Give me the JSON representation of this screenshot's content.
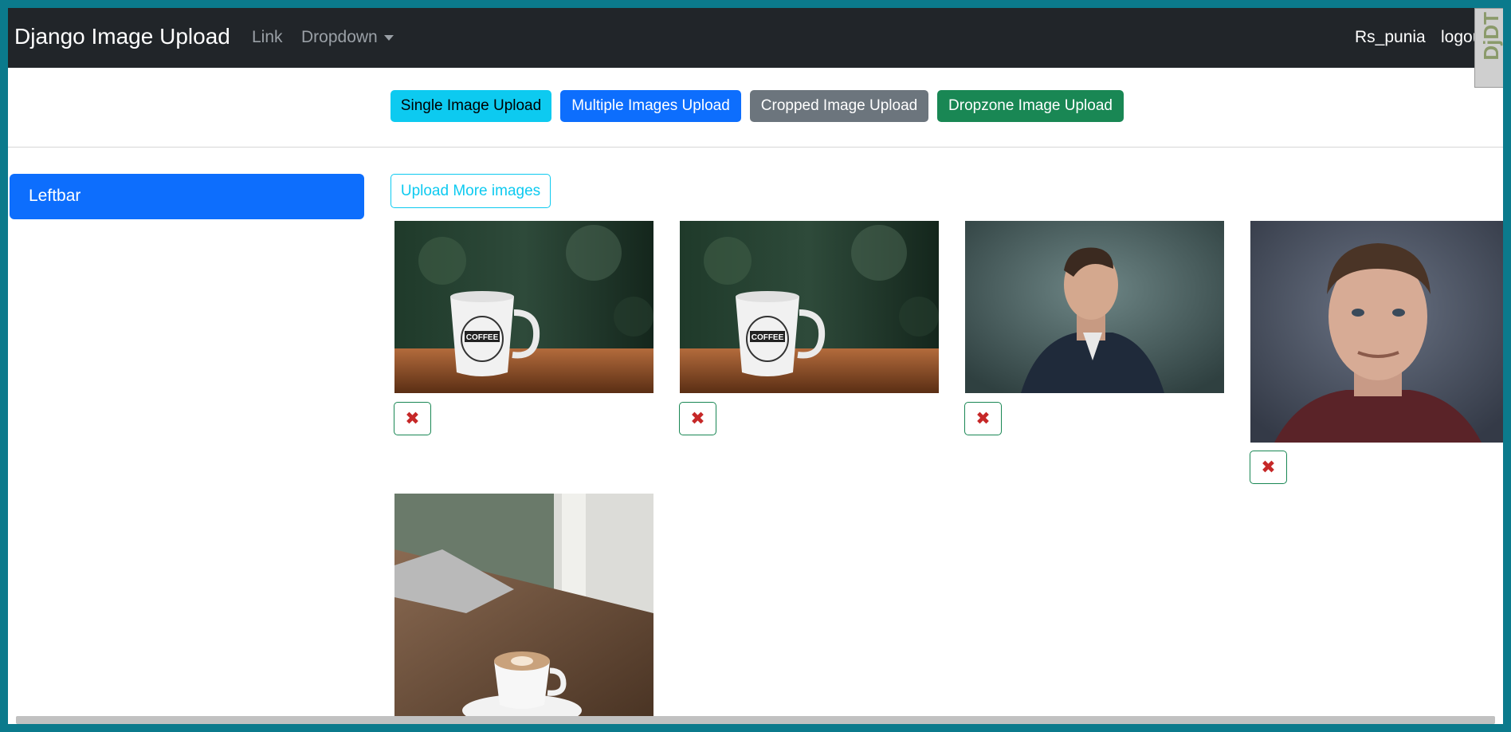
{
  "navbar": {
    "brand": "Django Image Upload",
    "link": "Link",
    "dropdown": "Dropdown",
    "user": "Rs_punia",
    "logout": "logout",
    "debug_toolbar": "DjDT"
  },
  "topbar": {
    "buttons": [
      {
        "label": "Single Image Upload",
        "color": "#0dcaf0",
        "text_color": "#000000"
      },
      {
        "label": "Multiple Images Upload",
        "color": "#0d6efd",
        "text_color": "#ffffff"
      },
      {
        "label": "Cropped Image Upload",
        "color": "#6c757d",
        "text_color": "#ffffff"
      },
      {
        "label": "Dropzone Image Upload",
        "color": "#198754",
        "text_color": "#ffffff"
      }
    ]
  },
  "sidebar": {
    "title": "Leftbar"
  },
  "main": {
    "upload_more": "Upload More images",
    "images": [
      {
        "subject": "coffee-mug"
      },
      {
        "subject": "coffee-mug"
      },
      {
        "subject": "man-profile"
      },
      {
        "subject": "man-portrait"
      },
      {
        "subject": "latte-cup"
      }
    ],
    "delete_icon": "✖"
  }
}
